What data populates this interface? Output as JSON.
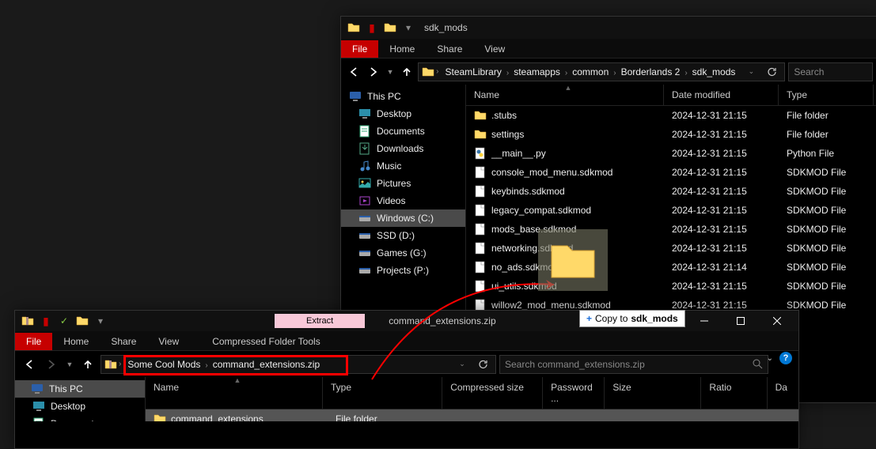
{
  "window1": {
    "title": "sdk_mods",
    "tabs": {
      "file": "File",
      "home": "Home",
      "share": "Share",
      "view": "View"
    },
    "breadcrumbs": [
      "SteamLibrary",
      "steamapps",
      "common",
      "Borderlands 2",
      "sdk_mods"
    ],
    "search_placeholder": "Search",
    "sidebar": {
      "root": "This PC",
      "items": [
        "Desktop",
        "Documents",
        "Downloads",
        "Music",
        "Pictures",
        "Videos",
        "Windows (C:)",
        "SSD (D:)",
        "Games (G:)",
        "Projects (P:)"
      ]
    },
    "columns": {
      "name": "Name",
      "date": "Date modified",
      "type": "Type"
    },
    "files": [
      {
        "name": ".stubs",
        "date": "2024-12-31 21:15",
        "type": "File folder",
        "icon": "folder"
      },
      {
        "name": "settings",
        "date": "2024-12-31 21:15",
        "type": "File folder",
        "icon": "folder"
      },
      {
        "name": "__main__.py",
        "date": "2024-12-31 21:15",
        "type": "Python File",
        "icon": "python"
      },
      {
        "name": "console_mod_menu.sdkmod",
        "date": "2024-12-31 21:15",
        "type": "SDKMOD File",
        "icon": "file"
      },
      {
        "name": "keybinds.sdkmod",
        "date": "2024-12-31 21:15",
        "type": "SDKMOD File",
        "icon": "file"
      },
      {
        "name": "legacy_compat.sdkmod",
        "date": "2024-12-31 21:15",
        "type": "SDKMOD File",
        "icon": "file"
      },
      {
        "name": "mods_base.sdkmod",
        "date": "2024-12-31 21:15",
        "type": "SDKMOD File",
        "icon": "file"
      },
      {
        "name": "networking.sdkmod",
        "date": "2024-12-31 21:15",
        "type": "SDKMOD File",
        "icon": "file"
      },
      {
        "name": "no_ads.sdkmod",
        "date": "2024-12-31 21:14",
        "type": "SDKMOD File",
        "icon": "file"
      },
      {
        "name": "ui_utils.sdkmod",
        "date": "2024-12-31 21:15",
        "type": "SDKMOD File",
        "icon": "file"
      },
      {
        "name": "willow2_mod_menu.sdkmod",
        "date": "2024-12-31 21:15",
        "type": "SDKMOD File",
        "icon": "file"
      }
    ],
    "col_widths": {
      "name": 250,
      "date": 145,
      "type": 120
    }
  },
  "window2": {
    "title": "command_extensions.zip",
    "contextual_tab": "Extract",
    "contextual_label": "Compressed Folder Tools",
    "tabs": {
      "file": "File",
      "home": "Home",
      "share": "Share",
      "view": "View"
    },
    "breadcrumbs": [
      "Some Cool Mods",
      "command_extensions.zip"
    ],
    "search_placeholder": "Search command_extensions.zip",
    "sidebar": {
      "root": "This PC",
      "items": [
        "Desktop",
        "Documents"
      ]
    },
    "columns": {
      "name": "Name",
      "type": "Type",
      "compressed": "Compressed size",
      "password": "Password ...",
      "size": "Size",
      "ratio": "Ratio",
      "da": "Da"
    },
    "files": [
      {
        "name": "command_extensions",
        "type": "File folder",
        "icon": "folder"
      }
    ],
    "col_widths": {
      "name": 230,
      "type": 155,
      "compressed": 130,
      "password": 80,
      "size": 125,
      "ratio": 85,
      "da": 40
    }
  },
  "drag": {
    "tooltip_action": "Copy to",
    "tooltip_dest": "sdk_mods"
  }
}
